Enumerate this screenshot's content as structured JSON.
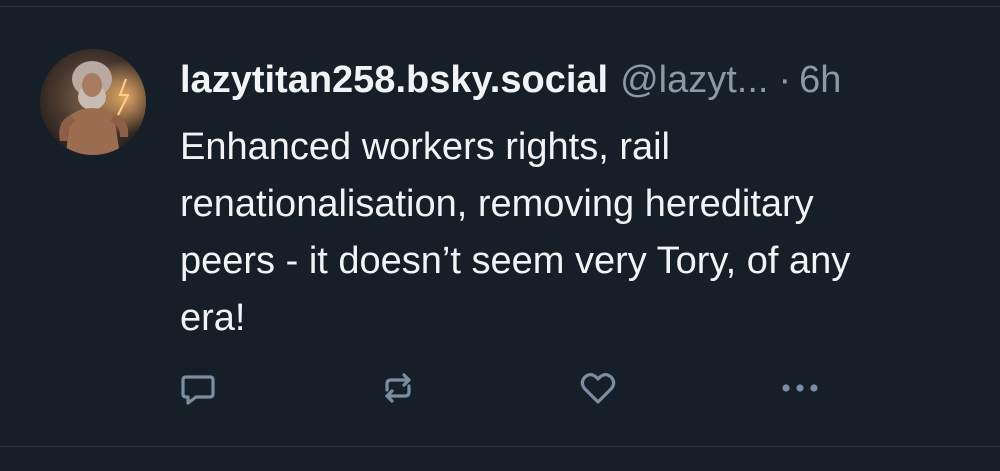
{
  "post": {
    "author": {
      "display_name": "lazytitan258.bsky.social",
      "handle": "@lazyt...",
      "avatar_icon": "avatar-image"
    },
    "separator": "·",
    "time_ago": "6h",
    "text": "Enhanced workers rights, rail renationalisation, removing hereditary peers - it doesn’t seem very Tory, of any era!",
    "actions": [
      {
        "name": "reply",
        "icon": "speech-bubble-icon"
      },
      {
        "name": "repost",
        "icon": "repost-arrows-icon"
      },
      {
        "name": "like",
        "icon": "heart-icon"
      },
      {
        "name": "more",
        "icon": "more-dots-icon"
      }
    ]
  },
  "colors": {
    "background": "#161e27",
    "text_primary": "#f1f3f5",
    "text_secondary": "#8b98a5",
    "divider": "#2a3440",
    "icon": "#7a8ea3"
  }
}
